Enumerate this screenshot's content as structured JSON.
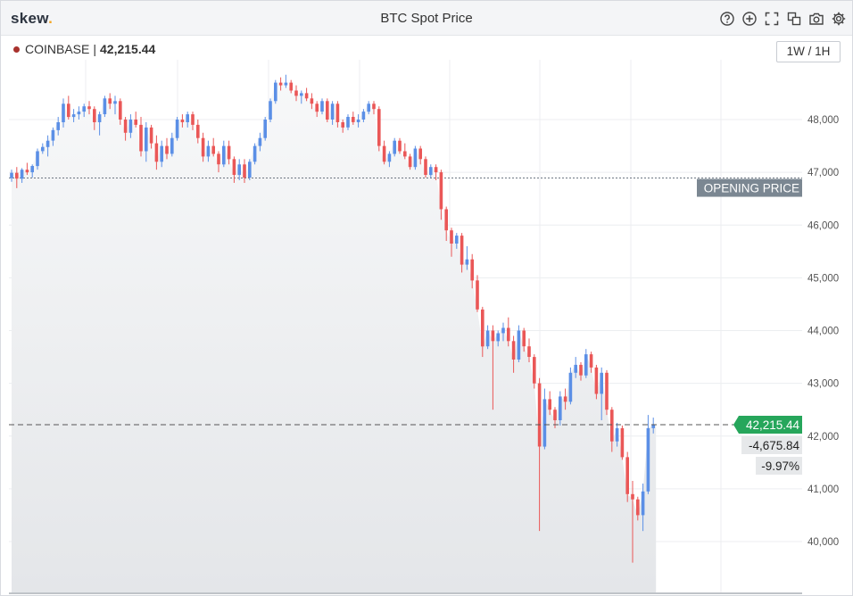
{
  "header": {
    "logo": "skew",
    "logo_dot": ".",
    "title": "BTC Spot Price",
    "icons": [
      "help-icon",
      "add-icon",
      "fullscreen-icon",
      "popout-icon",
      "camera-icon",
      "gear-icon"
    ]
  },
  "legend": {
    "exchange": "COINBASE",
    "separator": "|",
    "price": "42,215.44"
  },
  "timeframe_button": "1W / 1H",
  "colors": {
    "up": "#5b8fe6",
    "down": "#ea5757",
    "last_price_tag": "#26a65b",
    "opening_tag": "#7b8792",
    "change_tag": "#e6e8ea"
  },
  "chart_data": {
    "type": "candlestick",
    "title": "BTC Spot Price",
    "xlabel": "",
    "ylabel": "",
    "ylim": [
      39500,
      48900
    ],
    "y_ticks": [
      "40,000",
      "41,000",
      "42,000",
      "43,000",
      "44,000",
      "45,000",
      "46,000",
      "47,000",
      "48,000"
    ],
    "y_tick_values": [
      40000,
      41000,
      42000,
      43000,
      44000,
      45000,
      46000,
      47000,
      48000
    ],
    "grid": true,
    "opening_price": {
      "label": "OPENING PRICE",
      "value": 46891.28
    },
    "last_price": {
      "value": 42215.44,
      "label": "42,215.44"
    },
    "change": {
      "absolute": "-4,675.84",
      "percent": "-9.97%"
    },
    "candles": [
      [
        46890,
        47050,
        46820,
        46990
      ],
      [
        46990,
        47100,
        46700,
        46880
      ],
      [
        46880,
        47080,
        46800,
        47050
      ],
      [
        47050,
        47180,
        46950,
        47000
      ],
      [
        47000,
        47150,
        46900,
        47120
      ],
      [
        47120,
        47450,
        47050,
        47400
      ],
      [
        47400,
        47550,
        47350,
        47480
      ],
      [
        47480,
        47700,
        47300,
        47600
      ],
      [
        47600,
        47850,
        47500,
        47800
      ],
      [
        47800,
        48050,
        47700,
        47950
      ],
      [
        47950,
        48400,
        47850,
        48300
      ],
      [
        48300,
        48450,
        48000,
        48050
      ],
      [
        48050,
        48200,
        47950,
        48100
      ],
      [
        48100,
        48250,
        48000,
        48150
      ],
      [
        48150,
        48300,
        48050,
        48250
      ],
      [
        48250,
        48350,
        48100,
        48200
      ],
      [
        48200,
        48250,
        47800,
        47950
      ],
      [
        47950,
        48150,
        47700,
        48100
      ],
      [
        48100,
        48450,
        48050,
        48400
      ],
      [
        48400,
        48500,
        48200,
        48300
      ],
      [
        48300,
        48450,
        48100,
        48350
      ],
      [
        48350,
        48400,
        47900,
        48000
      ],
      [
        48000,
        48050,
        47600,
        47750
      ],
      [
        47750,
        48100,
        47650,
        48000
      ],
      [
        48000,
        48150,
        47850,
        47900
      ],
      [
        47900,
        48050,
        47300,
        47400
      ],
      [
        47400,
        47950,
        47200,
        47850
      ],
      [
        47850,
        47900,
        47450,
        47550
      ],
      [
        47550,
        47700,
        47050,
        47200
      ],
      [
        47200,
        47600,
        47100,
        47500
      ],
      [
        47500,
        47650,
        47250,
        47350
      ],
      [
        47350,
        47750,
        47300,
        47650
      ],
      [
        47650,
        48050,
        47600,
        48000
      ],
      [
        48000,
        48100,
        47850,
        47950
      ],
      [
        47950,
        48150,
        47850,
        48100
      ],
      [
        48100,
        48150,
        47800,
        47900
      ],
      [
        47900,
        48000,
        47550,
        47650
      ],
      [
        47650,
        47750,
        47200,
        47300
      ],
      [
        47300,
        47600,
        47200,
        47500
      ],
      [
        47500,
        47650,
        47300,
        47350
      ],
      [
        47350,
        47400,
        47000,
        47150
      ],
      [
        47150,
        47600,
        47100,
        47500
      ],
      [
        47500,
        47600,
        47150,
        47250
      ],
      [
        47250,
        47300,
        46800,
        46950
      ],
      [
        46950,
        47250,
        46850,
        47150
      ],
      [
        47150,
        47250,
        46800,
        46900
      ],
      [
        46900,
        47250,
        46850,
        47200
      ],
      [
        47200,
        47550,
        47150,
        47500
      ],
      [
        47500,
        47750,
        47400,
        47650
      ],
      [
        47650,
        48050,
        47600,
        48000
      ],
      [
        48000,
        48400,
        47950,
        48350
      ],
      [
        48350,
        48750,
        48300,
        48700
      ],
      [
        48700,
        48800,
        48550,
        48650
      ],
      [
        48650,
        48850,
        48600,
        48700
      ],
      [
        48700,
        48750,
        48500,
        48550
      ],
      [
        48550,
        48650,
        48350,
        48450
      ],
      [
        48450,
        48550,
        48300,
        48500
      ],
      [
        48500,
        48600,
        48350,
        48400
      ],
      [
        48400,
        48500,
        48200,
        48300
      ],
      [
        48300,
        48350,
        48050,
        48150
      ],
      [
        48150,
        48400,
        48100,
        48350
      ],
      [
        48350,
        48400,
        47950,
        48000
      ],
      [
        48000,
        48350,
        47900,
        48300
      ],
      [
        48300,
        48350,
        47850,
        47950
      ],
      [
        47950,
        48000,
        47750,
        47850
      ],
      [
        47850,
        48100,
        47800,
        48050
      ],
      [
        48050,
        48150,
        47900,
        47950
      ],
      [
        47950,
        48100,
        47850,
        48000
      ],
      [
        48000,
        48200,
        47950,
        48150
      ],
      [
        48150,
        48350,
        48100,
        48300
      ],
      [
        48300,
        48350,
        48100,
        48200
      ],
      [
        48200,
        48250,
        47400,
        47500
      ],
      [
        47500,
        47600,
        47150,
        47200
      ],
      [
        47200,
        47400,
        47100,
        47350
      ],
      [
        47350,
        47650,
        47300,
        47600
      ],
      [
        47600,
        47650,
        47350,
        47400
      ],
      [
        47400,
        47550,
        47250,
        47300
      ],
      [
        47300,
        47350,
        47050,
        47100
      ],
      [
        47100,
        47500,
        47050,
        47450
      ],
      [
        47450,
        47500,
        47150,
        47250
      ],
      [
        47250,
        47300,
        46900,
        46950
      ],
      [
        46950,
        47150,
        46900,
        47100
      ],
      [
        47100,
        47150,
        46850,
        47000
      ],
      [
        47000,
        47050,
        46100,
        46300
      ],
      [
        46300,
        46350,
        45700,
        45900
      ],
      [
        45900,
        45950,
        45400,
        45650
      ],
      [
        45650,
        45850,
        45550,
        45800
      ],
      [
        45800,
        45850,
        45100,
        45250
      ],
      [
        45250,
        45600,
        45150,
        45350
      ],
      [
        45350,
        45450,
        44800,
        44950
      ],
      [
        44950,
        45050,
        44350,
        44400
      ],
      [
        44400,
        44450,
        43500,
        43700
      ],
      [
        43700,
        44100,
        43650,
        44000
      ],
      [
        44000,
        44100,
        42500,
        43800
      ],
      [
        43800,
        44000,
        43700,
        43950
      ],
      [
        43950,
        44150,
        43800,
        44050
      ],
      [
        44050,
        44250,
        43700,
        43800
      ],
      [
        43800,
        43900,
        43200,
        43450
      ],
      [
        43450,
        44100,
        43400,
        44000
      ],
      [
        44000,
        44050,
        43600,
        43700
      ],
      [
        43700,
        43850,
        43400,
        43500
      ],
      [
        43500,
        43550,
        42900,
        43000
      ],
      [
        43000,
        43100,
        40200,
        41800
      ],
      [
        41800,
        42900,
        41750,
        42700
      ],
      [
        42700,
        42850,
        42400,
        42500
      ],
      [
        42500,
        42550,
        42150,
        42300
      ],
      [
        42300,
        42850,
        42200,
        42750
      ],
      [
        42750,
        42900,
        42500,
        42650
      ],
      [
        42650,
        43300,
        42600,
        43200
      ],
      [
        43200,
        43500,
        43100,
        43350
      ],
      [
        43350,
        43400,
        43050,
        43150
      ],
      [
        43150,
        43650,
        43100,
        43550
      ],
      [
        43550,
        43600,
        43200,
        43300
      ],
      [
        43300,
        43350,
        42700,
        42800
      ],
      [
        42800,
        43300,
        42300,
        43200
      ],
      [
        43200,
        43250,
        42400,
        42500
      ],
      [
        42500,
        42550,
        41700,
        41900
      ],
      [
        41900,
        42250,
        41800,
        42150
      ],
      [
        42150,
        42200,
        41550,
        41600
      ],
      [
        41600,
        41700,
        40750,
        40900
      ],
      [
        40900,
        41150,
        39600,
        40800
      ],
      [
        40800,
        40850,
        40400,
        40500
      ],
      [
        40500,
        41100,
        40200,
        40950
      ],
      [
        40950,
        42400,
        40900,
        42150
      ],
      [
        42150,
        42350,
        42050,
        42215.44
      ]
    ]
  }
}
